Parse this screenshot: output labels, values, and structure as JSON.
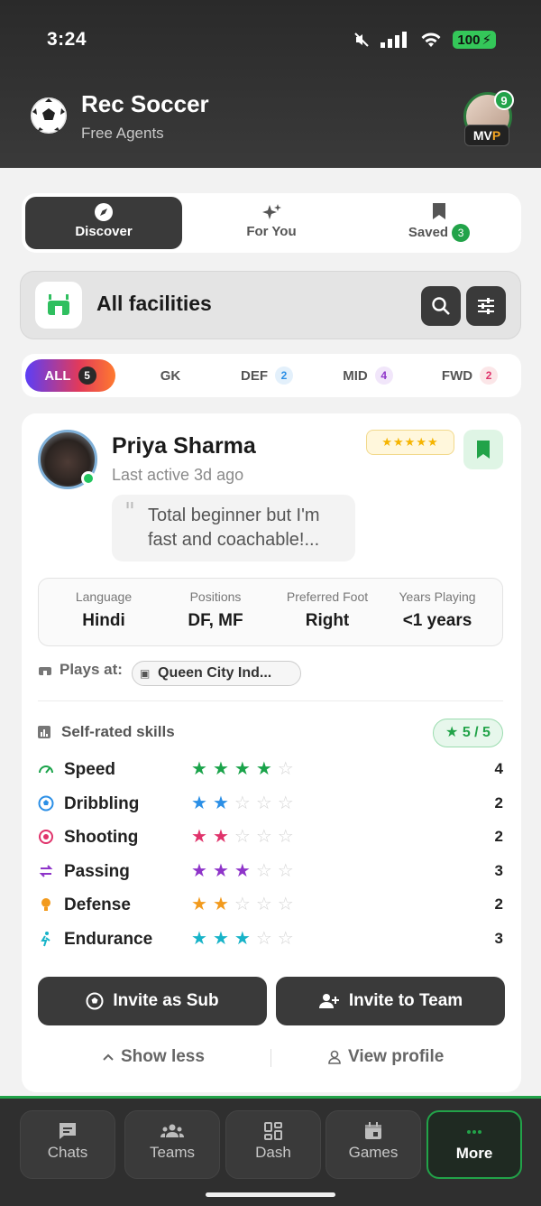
{
  "status": {
    "time": "3:24",
    "battery": "100"
  },
  "app": {
    "title": "Rec Soccer",
    "subtitle": "Free Agents",
    "notification_count": "9",
    "badge_mvp_m": "M",
    "badge_mvp_v": "V",
    "badge_mvp_p": "P"
  },
  "tabs": [
    {
      "label": "Discover",
      "icon": "compass-icon"
    },
    {
      "label": "For You",
      "icon": "sparkles-icon"
    },
    {
      "label": "Saved",
      "icon": "bookmark-icon",
      "count": "3"
    }
  ],
  "facility": {
    "title": "All facilities"
  },
  "filters": [
    {
      "label": "ALL",
      "count": "5"
    },
    {
      "label": "GK",
      "count": ""
    },
    {
      "label": "DEF",
      "count": "2"
    },
    {
      "label": "MID",
      "count": "4"
    },
    {
      "label": "FWD",
      "count": "2"
    }
  ],
  "player": {
    "name": "Priya Sharma",
    "last_active": "Last active 3d ago",
    "rating_stars": "★★★★★",
    "quote_line1": "Total beginner but I'm",
    "quote_line2": "fast and coachable!...",
    "stats": [
      {
        "label": "Language",
        "value": "Hindi"
      },
      {
        "label": "Positions",
        "value": "DF, MF"
      },
      {
        "label": "Preferred Foot",
        "value": "Right"
      },
      {
        "label": "Years Playing",
        "value": "<1 years"
      }
    ],
    "plays_at_label": "Plays at:",
    "venue": "Queen City Ind...",
    "skills_header": "Self-rated skills",
    "skills_score": "★ 5 / 5",
    "skills": [
      {
        "name": "Speed",
        "value": "4",
        "rating": 4,
        "color": "#1aa34a"
      },
      {
        "name": "Dribbling",
        "value": "2",
        "rating": 2,
        "color": "#2b8fe6"
      },
      {
        "name": "Shooting",
        "value": "2",
        "rating": 2,
        "color": "#e0336b"
      },
      {
        "name": "Passing",
        "value": "3",
        "rating": 3,
        "color": "#8e34c9"
      },
      {
        "name": "Defense",
        "value": "2",
        "rating": 2,
        "color": "#f29a1d"
      },
      {
        "name": "Endurance",
        "value": "3",
        "rating": 3,
        "color": "#17b3c8"
      }
    ],
    "invite_sub": "Invite as Sub",
    "invite_team": "Invite to Team",
    "show_less": "Show less",
    "view_profile": "View profile"
  },
  "nav": [
    {
      "label": "Chats",
      "icon": "chat-icon"
    },
    {
      "label": "Teams",
      "icon": "people-icon"
    },
    {
      "label": "Dash",
      "icon": "grid-icon"
    },
    {
      "label": "Games",
      "icon": "calendar-icon"
    },
    {
      "label": "More",
      "icon": "dots-icon"
    }
  ],
  "colors": {
    "accent": "#22a349",
    "dark": "#3a3a3a"
  }
}
